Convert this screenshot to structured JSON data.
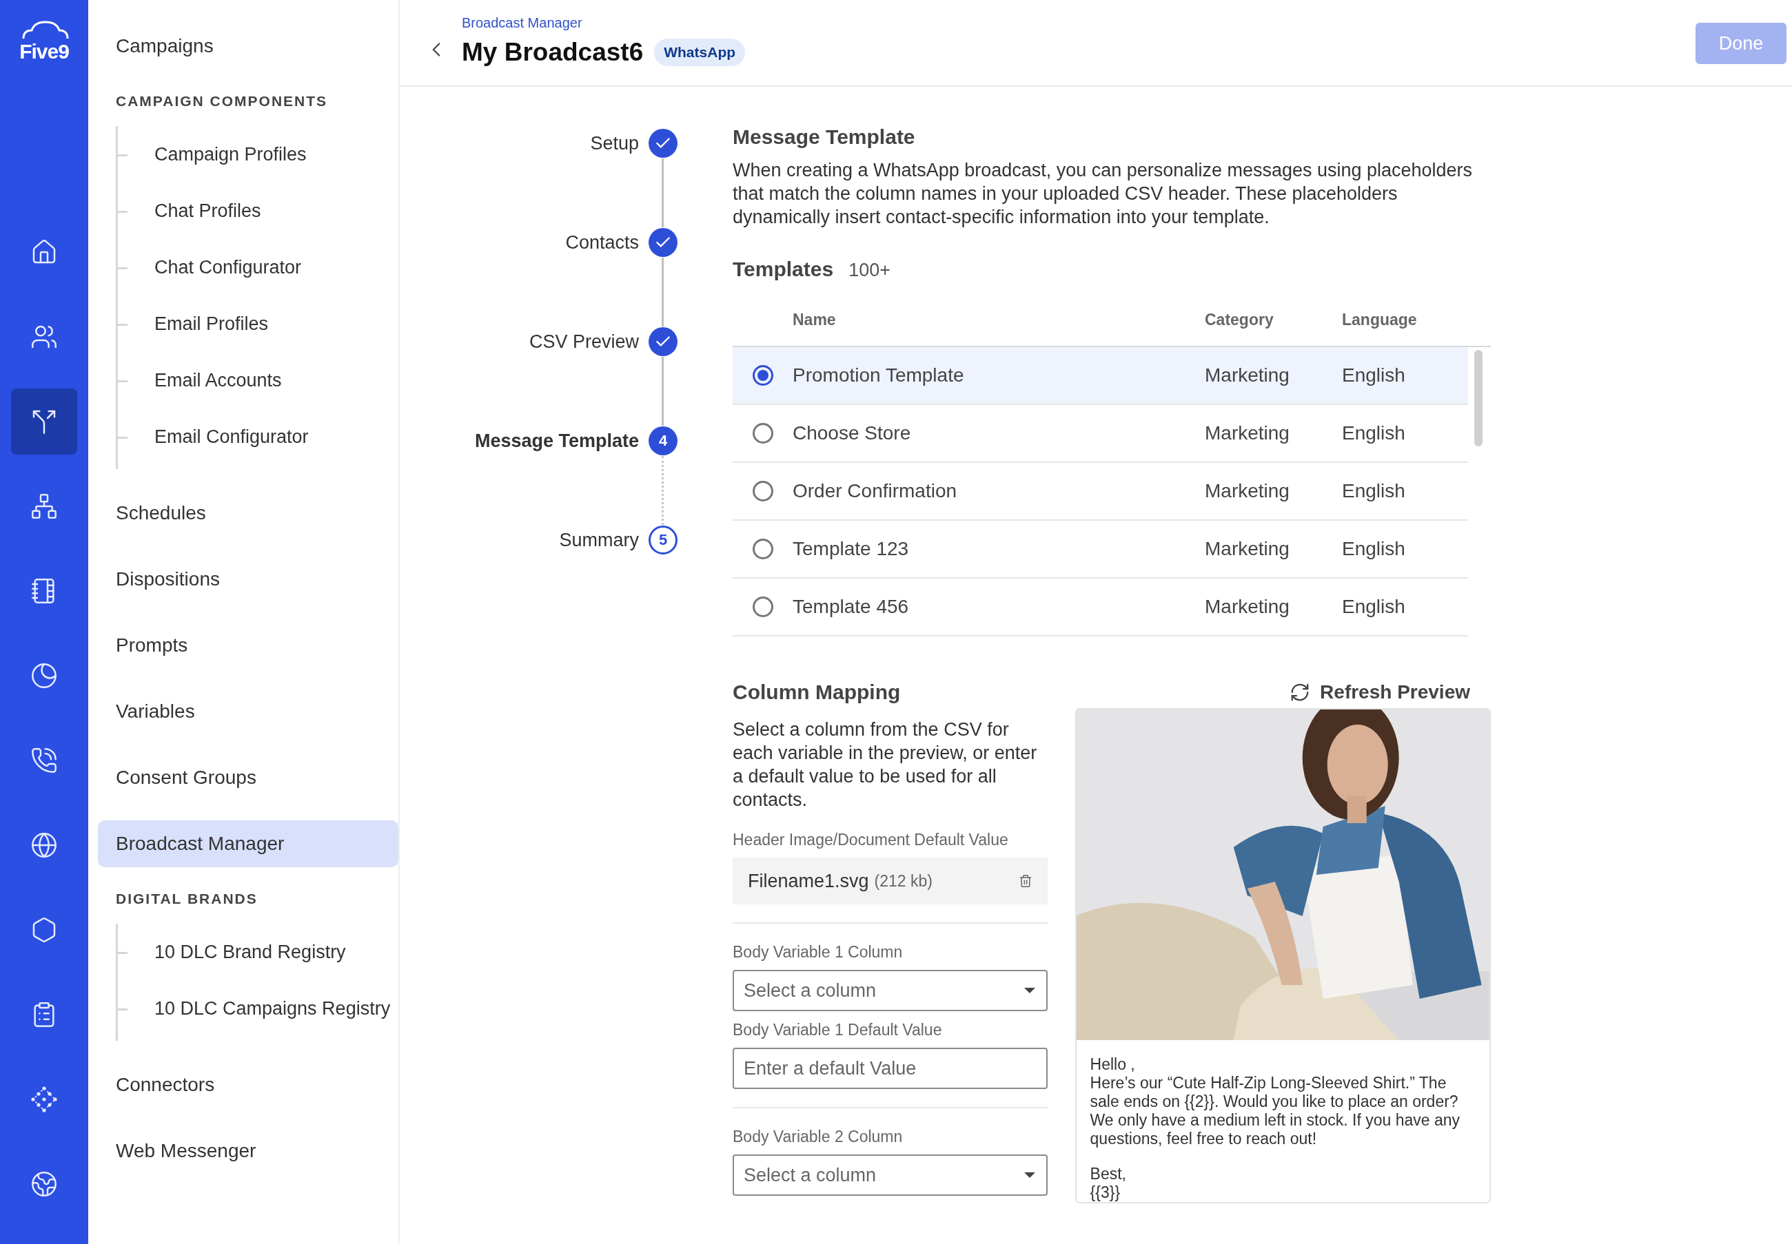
{
  "rail": {
    "logo": "Five9",
    "items": [
      {
        "selected": false
      },
      {
        "selected": false
      },
      {
        "selected": true
      },
      {
        "selected": false
      },
      {
        "selected": false
      },
      {
        "selected": false
      },
      {
        "selected": false
      },
      {
        "selected": false
      },
      {
        "selected": false
      },
      {
        "selected": false
      },
      {
        "selected": false
      },
      {
        "selected": false
      }
    ]
  },
  "nav": {
    "items": [
      {
        "kind": "link",
        "label": "Campaigns",
        "selected": false
      },
      {
        "kind": "heading",
        "label": "CAMPAIGN COMPONENTS"
      },
      {
        "kind": "group",
        "children": [
          {
            "label": "Campaign Profiles",
            "selected": false
          },
          {
            "label": "Chat Profiles",
            "selected": false
          },
          {
            "label": "Chat Configurator",
            "selected": false
          },
          {
            "label": "Email Profiles",
            "selected": false
          },
          {
            "label": "Email Accounts",
            "selected": false
          },
          {
            "label": "Email Configurator",
            "selected": false
          }
        ]
      },
      {
        "kind": "link",
        "label": "Schedules",
        "selected": false
      },
      {
        "kind": "link",
        "label": "Dispositions",
        "selected": false
      },
      {
        "kind": "link",
        "label": "Prompts",
        "selected": false
      },
      {
        "kind": "link",
        "label": "Variables",
        "selected": false
      },
      {
        "kind": "link",
        "label": "Consent Groups",
        "selected": false
      },
      {
        "kind": "link",
        "label": "Broadcast Manager",
        "selected": true
      },
      {
        "kind": "heading",
        "label": "DIGITAL BRANDS"
      },
      {
        "kind": "group",
        "children": [
          {
            "label": "10 DLC Brand Registry",
            "selected": false
          },
          {
            "label": "10 DLC Campaigns Registry",
            "selected": false
          }
        ]
      },
      {
        "kind": "link",
        "label": "Connectors",
        "selected": false
      },
      {
        "kind": "link",
        "label": "Web Messenger",
        "selected": false
      }
    ]
  },
  "header": {
    "breadcrumb": "Broadcast Manager",
    "title": "My Broadcast6",
    "badge": "WhatsApp",
    "done_button": {
      "label": "Done",
      "disabled": true
    }
  },
  "stepper": [
    {
      "label": "Setup",
      "completed": true,
      "current": false
    },
    {
      "label": "Contacts",
      "completed": true,
      "current": false
    },
    {
      "label": "CSV Preview",
      "completed": true,
      "current": false
    },
    {
      "label": "Message Template",
      "completed": false,
      "current": true,
      "number": "4"
    },
    {
      "label": "Summary",
      "completed": false,
      "current": false,
      "number": "5"
    }
  ],
  "message_template": {
    "title": "Message Template",
    "description": "When creating a WhatsApp broadcast, you can personalize messages using placeholders that match the column names in your uploaded CSV header. These placeholders dynamically insert contact-specific information into your template."
  },
  "templates": {
    "title": "Templates",
    "count": "100+",
    "columns": [
      "Name",
      "Category",
      "Language"
    ],
    "rows": [
      {
        "name": "Promotion Template",
        "category": "Marketing",
        "language": "English",
        "selected": true
      },
      {
        "name": "Choose Store",
        "category": "Marketing",
        "language": "English",
        "selected": false
      },
      {
        "name": "Order Confirmation",
        "category": "Marketing",
        "language": "English",
        "selected": false
      },
      {
        "name": "Template 123",
        "category": "Marketing",
        "language": "English",
        "selected": false
      },
      {
        "name": "Template 456",
        "category": "Marketing",
        "language": "English",
        "selected": false
      }
    ]
  },
  "column_mapping": {
    "title": "Column Mapping",
    "refresh": "Refresh Preview",
    "description": "Select a column from the CSV for each variable in the preview, or enter a default value to be used for all contacts.",
    "groups": [
      {
        "fields": [
          {
            "kind": "file",
            "label": "Header Image/Document Default Value",
            "filename": "Filename1.svg",
            "size": "(212 kb)"
          }
        ]
      },
      {
        "fields": [
          {
            "kind": "select",
            "label": "Body Variable 1 Column",
            "placeholder": "Select a column"
          },
          {
            "kind": "text",
            "label": "Body Variable 1 Default Value",
            "placeholder": "Enter a default Value"
          }
        ]
      },
      {
        "fields": [
          {
            "kind": "select",
            "label": "Body Variable 2 Column",
            "placeholder": "Select a column"
          }
        ]
      }
    ]
  },
  "preview": {
    "image": {
      "kind": "picture"
    },
    "paragraphs": [
      "Hello ,\nHere’s our “Cute Half-Zip Long-Sleeved Shirt.” The sale ends on {{2}}. Would you like to place an order? We only have a medium left in stock. If you have any questions, feel free to reach out!",
      "Best,\n{{3}}"
    ]
  }
}
